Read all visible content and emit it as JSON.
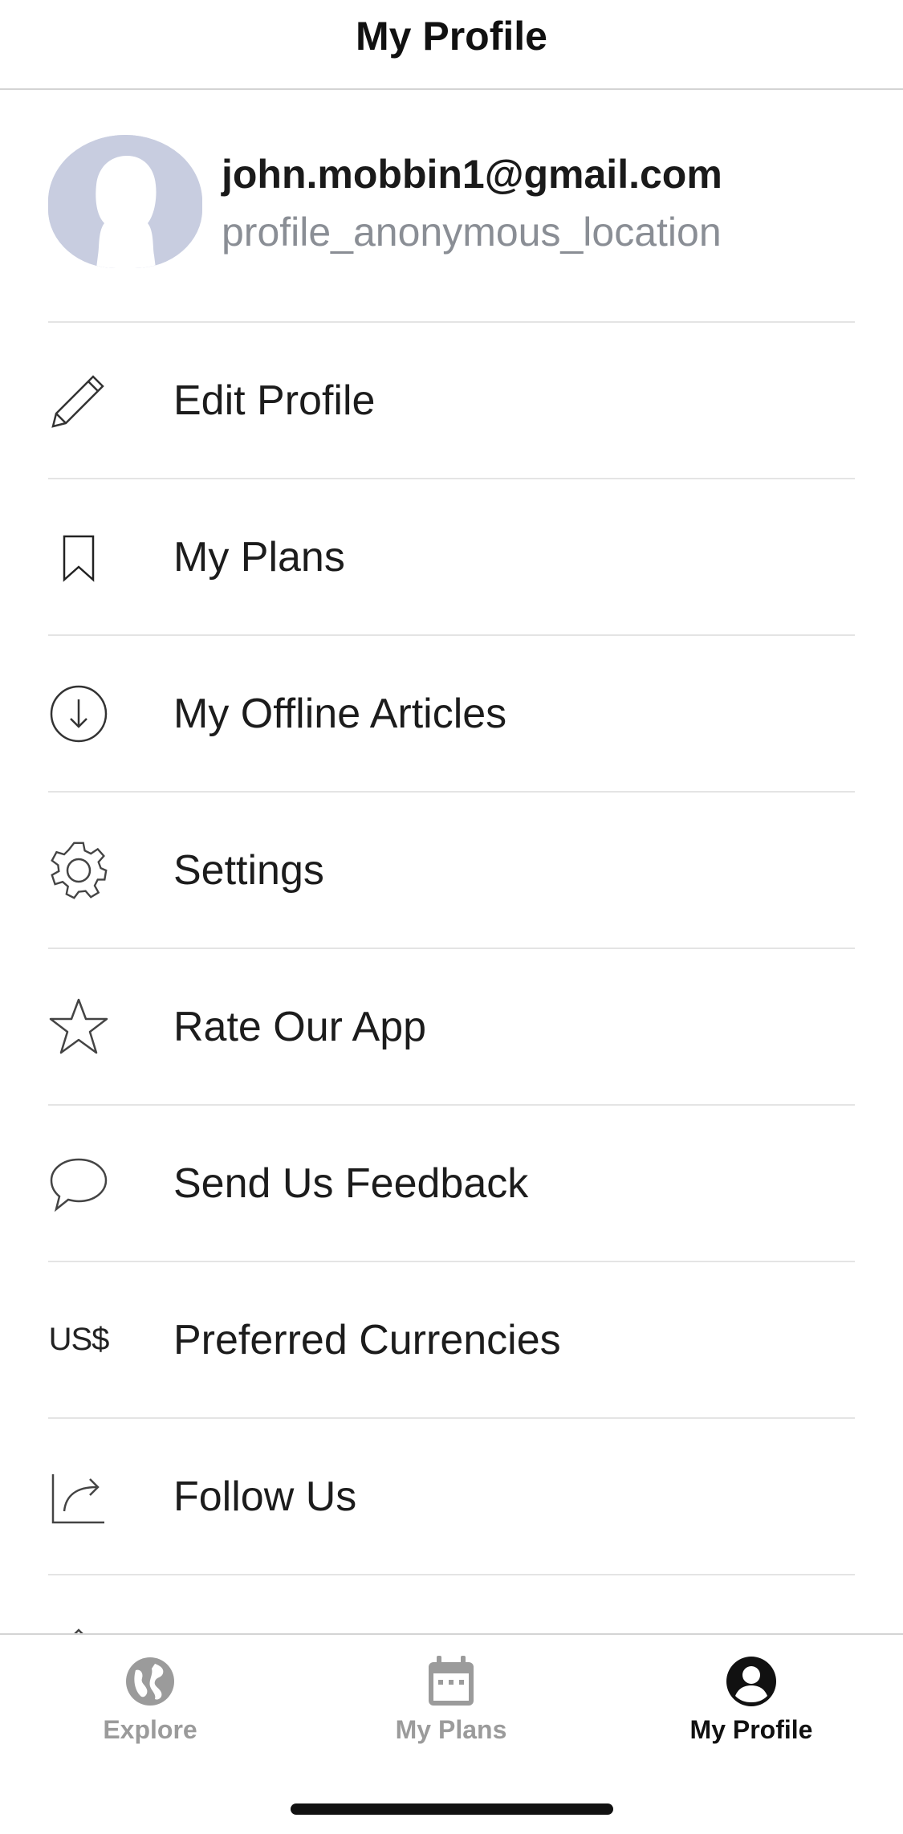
{
  "header": {
    "title": "My Profile"
  },
  "profile": {
    "email": "john.mobbin1@gmail.com",
    "location": "profile_anonymous_location",
    "avatar_color": "#c8cde0"
  },
  "menu": {
    "items": [
      {
        "label": "Edit Profile",
        "icon": "pencil-icon"
      },
      {
        "label": "My Plans",
        "icon": "bookmark-icon"
      },
      {
        "label": "My Offline Articles",
        "icon": "download-circle-icon"
      },
      {
        "label": "Settings",
        "icon": "gear-icon"
      },
      {
        "label": "Rate Our App",
        "icon": "star-icon"
      },
      {
        "label": "Send Us Feedback",
        "icon": "speech-bubble-icon"
      },
      {
        "label": "Preferred Currencies",
        "icon": "currency-icon",
        "icon_text": "US$"
      },
      {
        "label": "Follow Us",
        "icon": "share-icon"
      }
    ]
  },
  "tabbar": {
    "tabs": [
      {
        "label": "Explore",
        "icon": "globe-icon",
        "active": false
      },
      {
        "label": "My Plans",
        "icon": "calendar-icon",
        "active": false
      },
      {
        "label": "My Profile",
        "icon": "person-circle-icon",
        "active": true
      }
    ],
    "active_color": "#111111",
    "inactive_color": "#9b9b9b"
  }
}
